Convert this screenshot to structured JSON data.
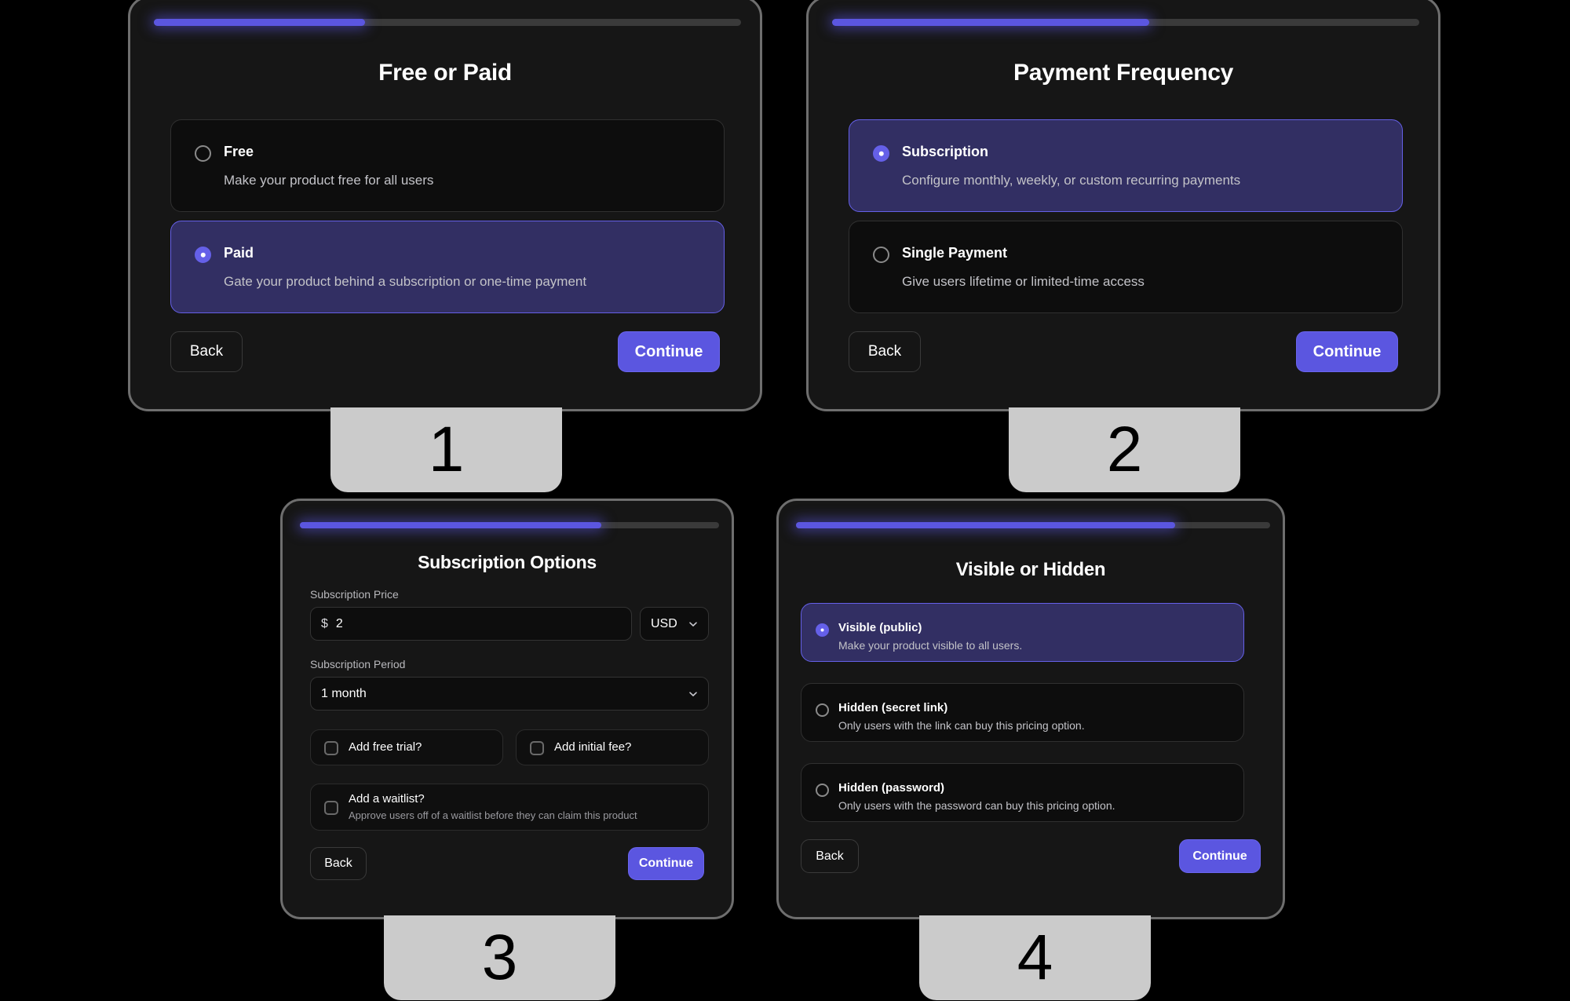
{
  "theme": {
    "accent": "#5b56e0",
    "selected_bg": "#322f63",
    "selected_border": "#6560e8",
    "card_bg": "#161616",
    "card_border": "#6e6e6e",
    "badge_bg": "#cbcbcb",
    "text_primary": "#ffffff",
    "text_secondary": "#c3c3c8"
  },
  "panels": [
    {
      "badge": "1",
      "progress_percent": 36,
      "title": "Free or Paid",
      "options": [
        {
          "label": "Free",
          "desc": "Make your product free for all users",
          "selected": false
        },
        {
          "label": "Paid",
          "desc": "Gate your product behind a subscription or one-time payment",
          "selected": true
        }
      ],
      "back_label": "Back",
      "continue_label": "Continue"
    },
    {
      "badge": "2",
      "progress_percent": 54,
      "title": "Payment Frequency",
      "options": [
        {
          "label": "Subscription",
          "desc": "Configure monthly, weekly, or custom recurring payments",
          "selected": true
        },
        {
          "label": "Single Payment",
          "desc": "Give users lifetime or limited-time access",
          "selected": false
        }
      ],
      "back_label": "Back",
      "continue_label": "Continue"
    },
    {
      "badge": "3",
      "progress_percent": 72,
      "title": "Subscription Options",
      "price_field_label": "Subscription Price",
      "price_prefix": "$",
      "price_value": "2",
      "currency_value": "USD",
      "period_field_label": "Subscription Period",
      "period_value": "1 month",
      "checkboxes": [
        {
          "label": "Add free trial?",
          "checked": false
        },
        {
          "label": "Add initial fee?",
          "checked": false
        },
        {
          "label": "Add a waitlist?",
          "desc": "Approve users off of a waitlist before they can claim this product",
          "checked": false
        }
      ],
      "back_label": "Back",
      "continue_label": "Continue"
    },
    {
      "badge": "4",
      "progress_percent": 80,
      "title": "Visible or Hidden",
      "options": [
        {
          "label": "Visible (public)",
          "desc": "Make your product visible to all users.",
          "selected": true
        },
        {
          "label": "Hidden (secret link)",
          "desc": "Only users with the link can buy this pricing option.",
          "selected": false
        },
        {
          "label": "Hidden (password)",
          "desc": "Only users with the password can buy this pricing option.",
          "selected": false
        }
      ],
      "back_label": "Back",
      "continue_label": "Continue"
    }
  ]
}
